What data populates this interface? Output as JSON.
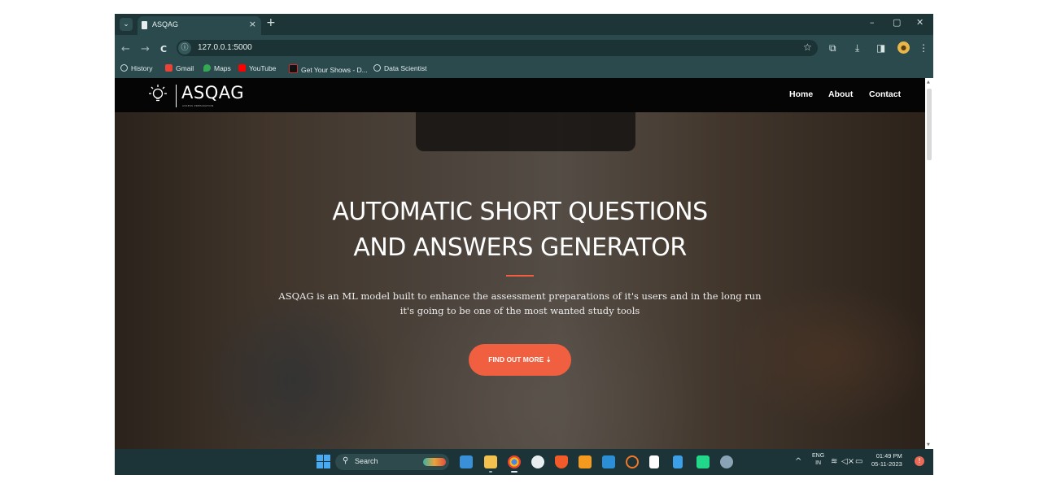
{
  "browser": {
    "tab": {
      "title": "ASQAG",
      "close": "×",
      "new_tab": "+"
    },
    "window_controls": {
      "minimize": "–",
      "maximize": "▢",
      "close": "✕"
    },
    "nav": {
      "back": "←",
      "forward": "→",
      "reload": "C"
    },
    "url": "127.0.0.1:5000",
    "bookmarks": [
      {
        "label": "History",
        "icon": "history-icon",
        "color": "#d0dcdc"
      },
      {
        "label": "Gmail",
        "icon": "gmail-icon",
        "color": "#ea4335"
      },
      {
        "label": "Maps",
        "icon": "maps-icon",
        "color": "#34a853"
      },
      {
        "label": "YouTube",
        "icon": "youtube-icon",
        "color": "#ff0000"
      },
      {
        "label": "Get Your Shows - D...",
        "icon": "shows-icon",
        "color": "#111111"
      },
      {
        "label": "Data Scientist",
        "icon": "globe-icon",
        "color": "#d0dcdc"
      }
    ]
  },
  "site": {
    "logo": {
      "text": "ASQAG",
      "subtext": "ASSESS PREPARATION"
    },
    "nav_links": [
      "Home",
      "About",
      "Contact"
    ],
    "hero": {
      "title_line1": "AUTOMATIC SHORT QUESTIONS",
      "title_line2": "AND ANSWERS GENERATOR",
      "description_line1": "ASQAG is an ML model built to enhance the assessment preparations of it's users and in the long run",
      "description_line2": "it's going to be one of the most wanted study tools",
      "cta": "FIND OUT MORE ⇣"
    },
    "accent_color": "#f05f40"
  },
  "taskbar": {
    "search_label": "Search",
    "tray": {
      "lang_line1": "ENG",
      "lang_line2": "IN",
      "time": "01:49 PM",
      "date": "05-11-2023",
      "notif": "!"
    }
  }
}
